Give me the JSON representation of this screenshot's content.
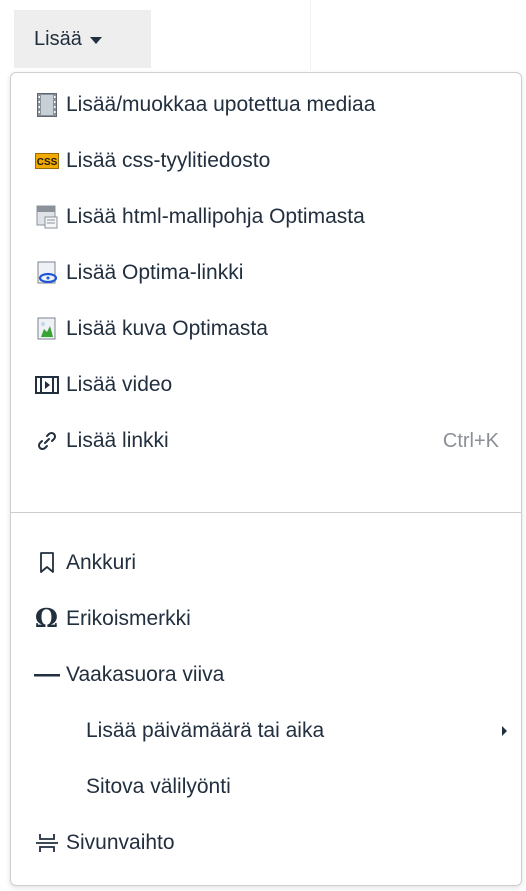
{
  "menubar": {
    "insert_label": "Lisää"
  },
  "menu": {
    "items": [
      {
        "label": "Lisää/muokkaa upotettua mediaa",
        "icon": "film-strip-icon"
      },
      {
        "label": "Lisää css-tyylitiedosto",
        "icon": "css-icon"
      },
      {
        "label": "Lisää html-mallipohja Optimasta",
        "icon": "html-template-icon"
      },
      {
        "label": "Lisää Optima-linkki",
        "icon": "optima-link-icon"
      },
      {
        "label": "Lisää kuva Optimasta",
        "icon": "image-icon"
      },
      {
        "label": "Lisää video",
        "icon": "video-icon"
      },
      {
        "label": "Lisää linkki",
        "icon": "link-icon",
        "shortcut": "Ctrl+K"
      },
      {
        "label": "Ankkuri",
        "icon": "bookmark-icon"
      },
      {
        "label": "Erikoismerkki",
        "icon": "omega-icon",
        "glyph": "Ω"
      },
      {
        "label": "Vaakasuora viiva",
        "icon": "horizontal-line-icon"
      },
      {
        "label": "Lisää päivämäärä tai aika",
        "icon": "",
        "has_submenu": true
      },
      {
        "label": "Sitova välilyönti",
        "icon": ""
      },
      {
        "label": "Sivunvaihto",
        "icon": "page-break-icon"
      }
    ]
  },
  "colors": {
    "text": "#222f3e",
    "shortcut_text": "#8a8f97",
    "button_bg": "#eeeeee",
    "menu_border": "#cfcfcf"
  }
}
